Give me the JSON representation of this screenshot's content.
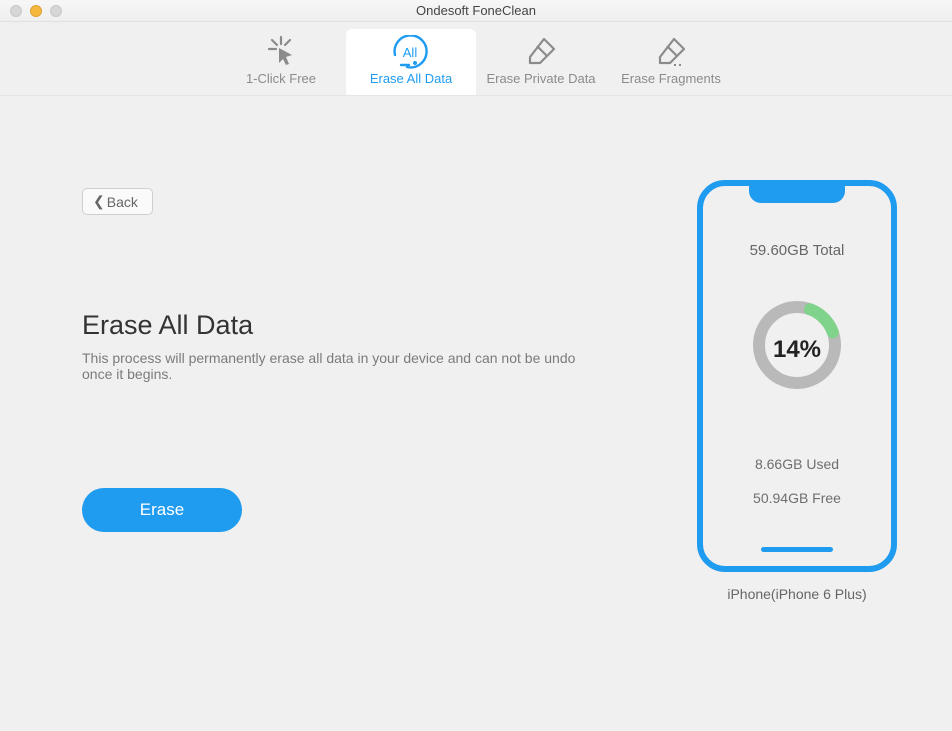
{
  "window": {
    "title": "Ondesoft FoneClean"
  },
  "tabs": [
    {
      "label": "1-Click Free"
    },
    {
      "label": "Erase All Data"
    },
    {
      "label": "Erase Private Data"
    },
    {
      "label": "Erase Fragments"
    }
  ],
  "active_tab_index": 1,
  "back_label": "Back",
  "main": {
    "heading": "Erase All Data",
    "subtext": "This process will permanently erase all data in your device and can not be undo once it begins.",
    "erase_label": "Erase"
  },
  "device": {
    "total_label": "59.60GB Total",
    "used_label": "8.66GB Used",
    "free_label": "50.94GB Free",
    "percent_label": "14%",
    "percent_value": 14,
    "name": "iPhone(iPhone 6 Plus)"
  },
  "colors": {
    "accent": "#1f9cf0",
    "ring_bg": "#b9b9b9",
    "ring_used": "#7fd38a"
  },
  "chart_data": {
    "type": "pie",
    "title": "Storage usage",
    "series": [
      {
        "name": "Used",
        "value": 8.66,
        "unit": "GB",
        "color": "#7fd38a"
      },
      {
        "name": "Free",
        "value": 50.94,
        "unit": "GB",
        "color": "#b9b9b9"
      }
    ],
    "total": 59.6,
    "percent_used": 14
  }
}
